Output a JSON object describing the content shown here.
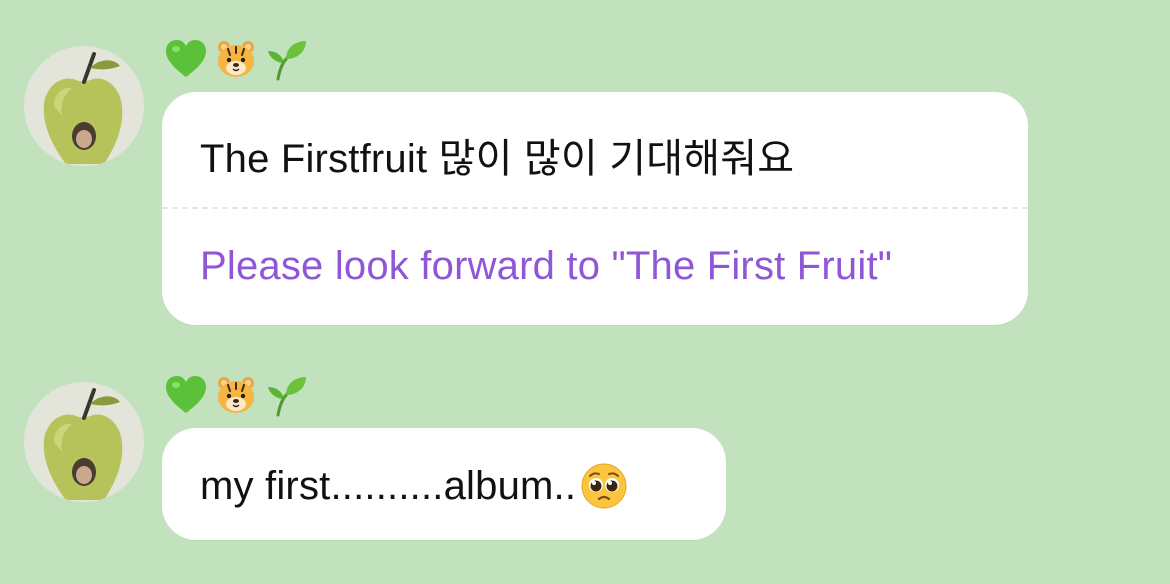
{
  "messages": [
    {
      "sender_emojis": [
        "green-heart",
        "tiger-face",
        "seedling"
      ],
      "original_text": "The Firstfruit 많이 많이 기대해줘요",
      "translation": "Please look forward to \"The First Fruit\""
    },
    {
      "sender_emojis": [
        "green-heart",
        "tiger-face",
        "seedling"
      ],
      "text": "my first..........album..",
      "trailing_emoji": "pleading-face"
    }
  ],
  "colors": {
    "background": "#c1e2bd",
    "bubble": "#ffffff",
    "translation": "#8f56d6",
    "text": "#111111"
  }
}
